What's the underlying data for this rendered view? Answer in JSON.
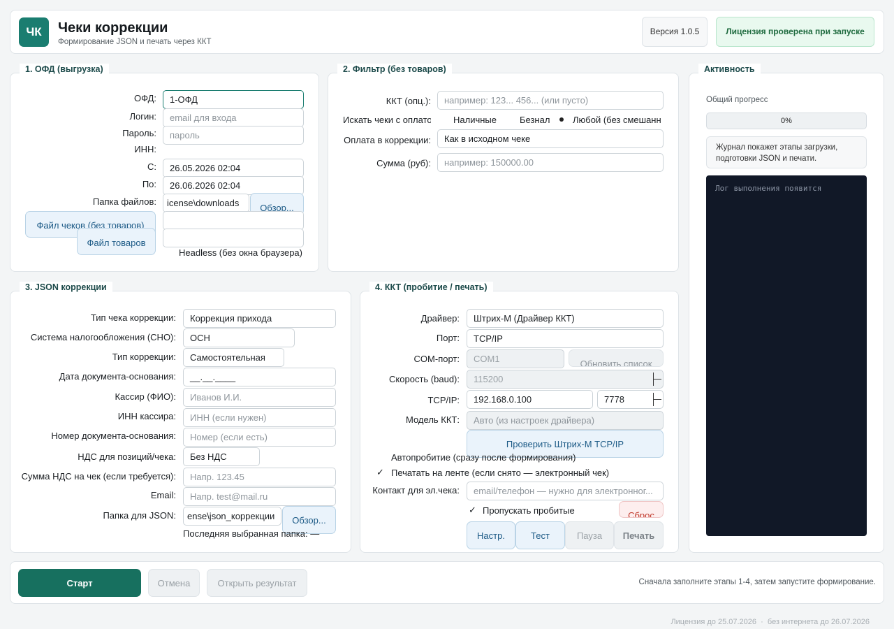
{
  "header": {
    "logo": "ЧК",
    "title": "Чеки коррекции",
    "subtitle": "Формирование JSON и печать через ККТ",
    "version": "Версия 1.0.5",
    "license": "Лицензия проверена при запуске"
  },
  "ofd": {
    "legend": "1. ОФД (выгрузка)",
    "ofd_label": "ОФД:",
    "ofd_value": "1-ОФД",
    "login_label": "Логин:",
    "login_placeholder": "email для входа",
    "password_label": "Пароль:",
    "password_placeholder": "пароль",
    "inn_label": "ИНН:",
    "from_label": "С:",
    "from_value": "26.05.2026 02:04",
    "to_label": "По:",
    "to_value": "26.06.2026 02:04",
    "folder_label": "Папка файлов:",
    "folder_value": "icense\\downloads",
    "browse_button": "Обзор...",
    "checks_file_button": "Файл чеков (без товаров)",
    "goods_file_button": "Файл товаров",
    "headless_label": "Headless (без окна браузера)"
  },
  "filter": {
    "legend": "2. Фильтр (без товаров)",
    "kkt_label": "ККТ (опц.):",
    "kkt_placeholder": "например: 123... 456... (или пусто)",
    "payment_search_label": "Искать чеки с оплато",
    "opt_cash": "Наличные",
    "opt_card": "Безнал",
    "opt_any": "Любой (без смешанн",
    "correction_payment_label": "Оплата в коррекции:",
    "correction_payment_value": "Как в исходном чеке",
    "sum_label": "Сумма (руб):",
    "sum_placeholder": "например: 150000.00"
  },
  "json": {
    "legend": "3. JSON коррекции",
    "type_label": "Тип чека коррекции:",
    "type_value": "Коррекция прихода",
    "sno_label": "Система налогообложения (СНО):",
    "sno_value": "ОСН",
    "corr_type_label": "Тип коррекции:",
    "corr_type_value": "Самостоятельная",
    "doc_date_label": "Дата документа-основания:",
    "doc_date_value": "__.__.____",
    "cashier_label": "Кассир (ФИО):",
    "cashier_placeholder": "Иванов И.И.",
    "cashier_inn_label": "ИНН кассира:",
    "cashier_inn_placeholder": "ИНН (если нужен)",
    "doc_number_label": "Номер документа-основания:",
    "doc_number_placeholder": "Номер (если есть)",
    "vat_label": "НДС для позиций/чека:",
    "vat_value": "Без НДС",
    "vat_sum_label": "Сумма НДС на чек (если требуется):",
    "vat_sum_placeholder": "Напр. 123.45",
    "email_label": "Email:",
    "email_placeholder": "Напр. test@mail.ru",
    "folder_label": "Папка для JSON:",
    "folder_value": "ense\\json_коррекции",
    "browse_button": "Обзор...",
    "last_folder": "Последняя выбранная папка: —"
  },
  "kkt": {
    "legend": "4. ККТ (пробитие / печать)",
    "driver_label": "Драйвер:",
    "driver_value": "Штрих-М (Драйвер ККТ)",
    "port_label": "Порт:",
    "port_value": "TCP/IP",
    "com_label": "COM-порт:",
    "com_value": "COM1",
    "refresh_button": "Обновить список",
    "baud_label": "Скорость (baud):",
    "baud_value": "115200",
    "tcp_label": "TCP/IP:",
    "tcp_ip": "192.168.0.100",
    "tcp_port": "7778",
    "model_label": "Модель ККТ:",
    "model_value": "Авто (из настроек драйвера)",
    "check_button": "Проверить Штрих-М TCP/IP",
    "auto_print": "Автопробитие (сразу после формирования)",
    "print_tape": "Печатать на ленте (если снято — электронный чек)",
    "contact_label": "Контакт для эл.чека:",
    "contact_placeholder": "email/телефон — нужно для электронног...",
    "skip_printed": "Пропускать пробитые",
    "reset_button": "Сброс",
    "settings_button": "Настр.",
    "test_button": "Тест",
    "pause_button": "Пауза",
    "print_button": "Печать"
  },
  "activity": {
    "legend": "Активность",
    "progress_label": "Общий прогресс",
    "progress_text": "0%",
    "progress_value": 0,
    "journal_hint": "Журнал покажет этапы загрузки, подготовки JSON и печати.",
    "log_placeholder": "Лог выполнения появится"
  },
  "footer": {
    "start_button": "Старт",
    "cancel_button": "Отмена",
    "open_result_button": "Открыть результат",
    "hint": "Сначала заполните этапы 1-4, затем запустите формирование.",
    "license_line": "Лицензия до 25.07.2026  ·  без интернета до 26.07.2026"
  },
  "colors": {
    "accent": "#1a7d70",
    "log_bg": "#111827"
  }
}
